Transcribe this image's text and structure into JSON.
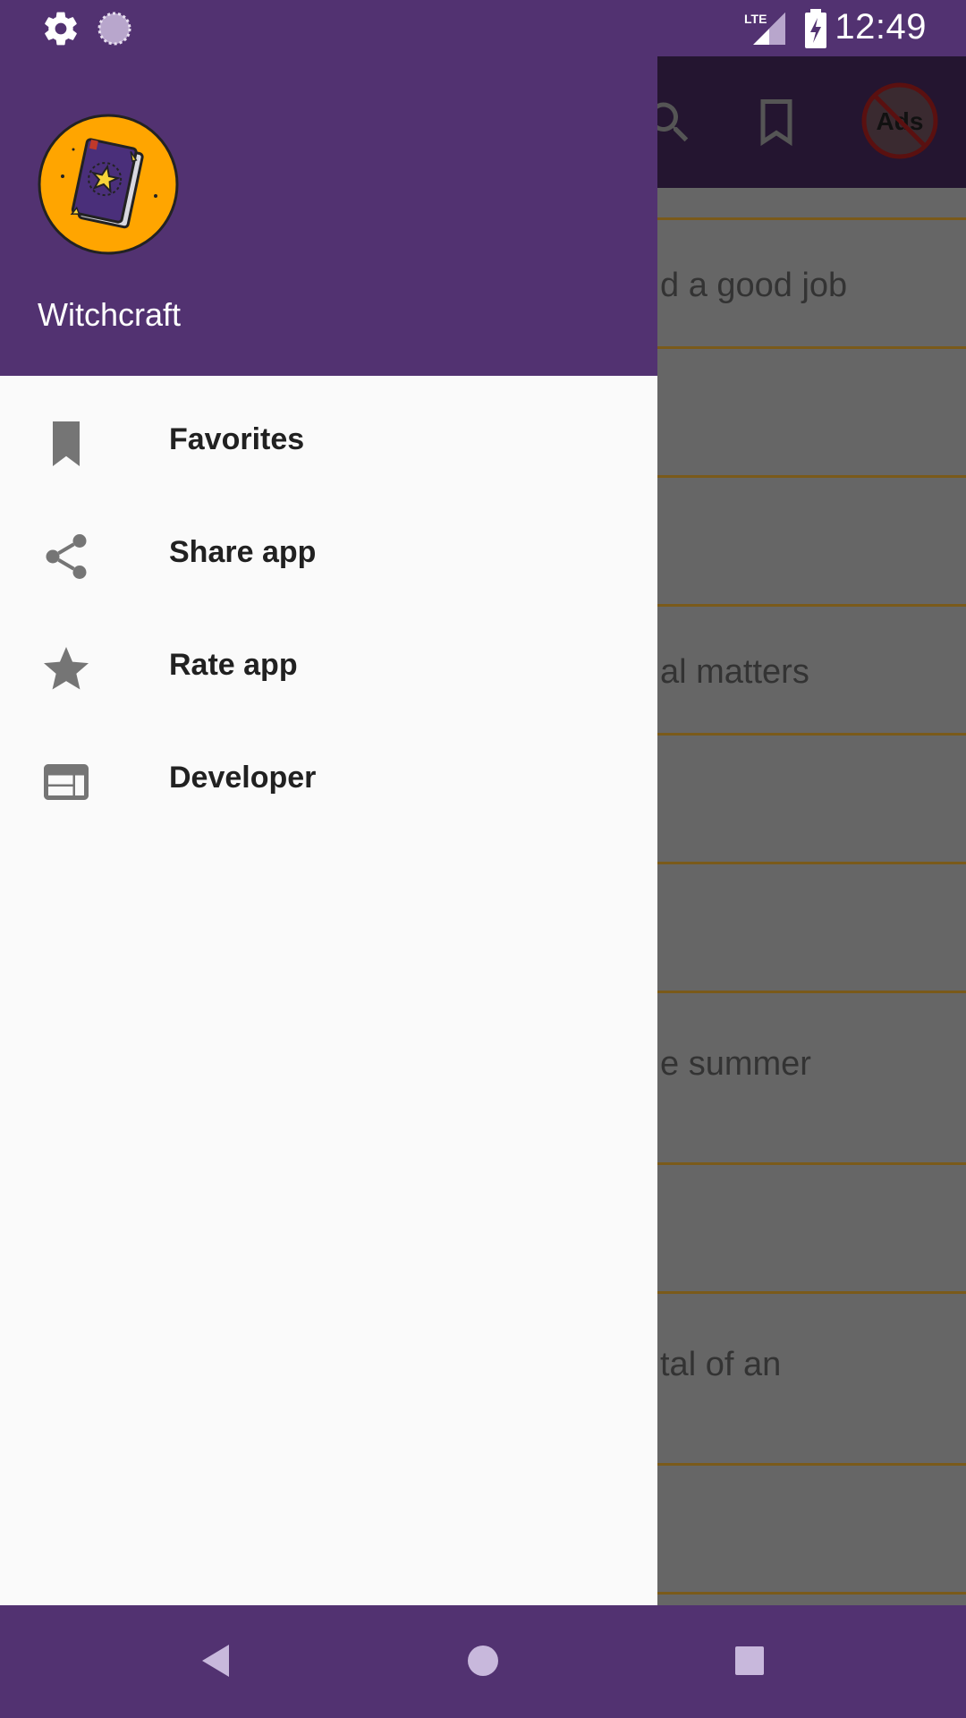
{
  "status_bar": {
    "time": "12:49",
    "network": "LTE",
    "icons": [
      "settings-icon",
      "sync-icon",
      "signal-icon",
      "battery-charging-icon"
    ]
  },
  "app_bar": {
    "icons": [
      "search-icon",
      "bookmark-icon",
      "no-ads-icon"
    ],
    "no_ads_label": "Ads"
  },
  "background_list": {
    "items": [
      {
        "text": "d a good job"
      },
      {
        "text": ""
      },
      {
        "text": ""
      },
      {
        "text": "al matters"
      },
      {
        "text": ""
      },
      {
        "text": ""
      },
      {
        "text": "e summer"
      },
      {
        "text": ""
      },
      {
        "text": "tal of an"
      },
      {
        "text": ""
      }
    ]
  },
  "drawer": {
    "app_name": "Witchcraft",
    "logo": "spellbook-logo",
    "items": [
      {
        "label": "Favorites",
        "icon": "bookmark-icon"
      },
      {
        "label": "Share app",
        "icon": "share-icon"
      },
      {
        "label": "Rate app",
        "icon": "star-icon"
      },
      {
        "label": "Developer",
        "icon": "web-icon"
      }
    ]
  },
  "nav_bar": {
    "buttons": [
      "back-icon",
      "home-icon",
      "recents-icon"
    ]
  },
  "colors": {
    "primary": "#523271",
    "app_bar_dimmed": "#241530",
    "scrim_background": "#666666",
    "divider": "#7a5a1a",
    "logo_bg": "#FFA500",
    "drawer_bg": "#fafafa"
  }
}
